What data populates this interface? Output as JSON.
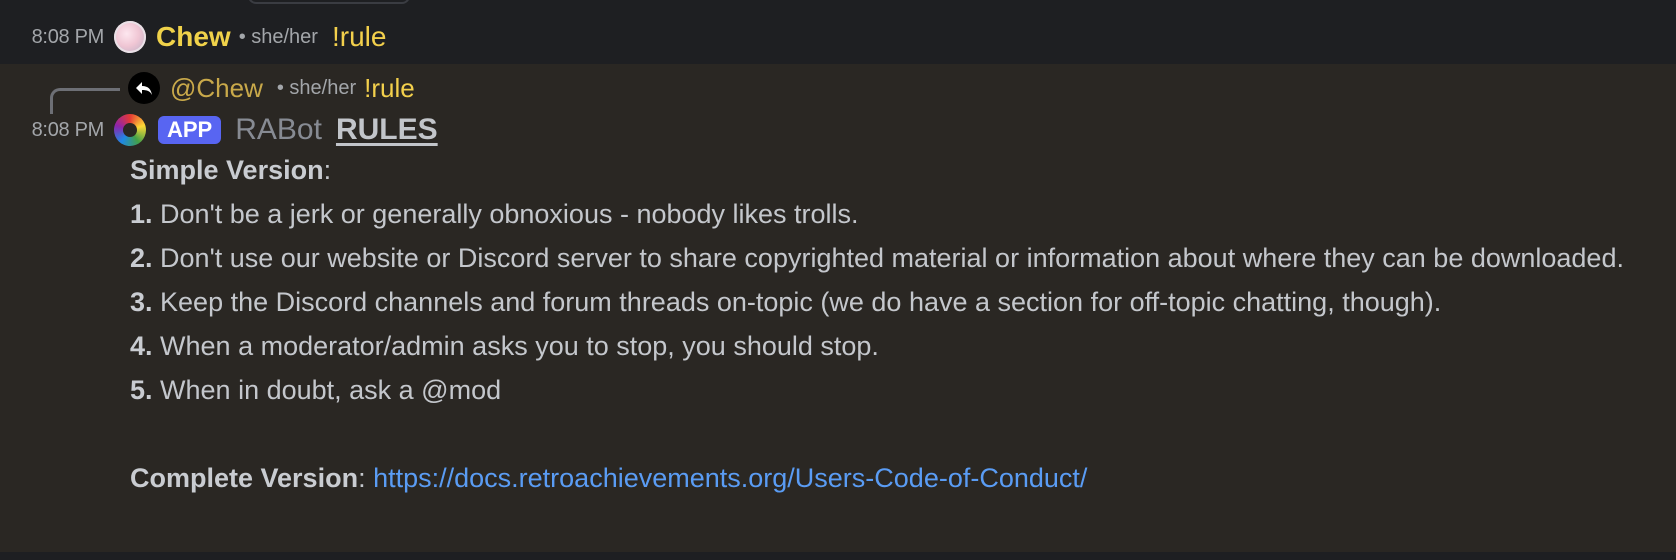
{
  "message1": {
    "timestamp": "8:08 PM",
    "author": "Chew",
    "pronouns": "• she/her",
    "text": "!rule"
  },
  "message2": {
    "reply": {
      "author": "@Chew",
      "pronouns": "• she/her",
      "text": "!rule"
    },
    "timestamp": "8:08 PM",
    "app_badge": "APP",
    "author": "RABot",
    "title": "RULES",
    "simple_label": "Simple Version",
    "colon": ":",
    "rules": [
      {
        "num": "1.",
        "text": " Don't be a jerk or generally obnoxious - nobody likes trolls."
      },
      {
        "num": "2.",
        "text": " Don't use our website or Discord server to share copyrighted material or information about where they can be downloaded."
      },
      {
        "num": "3.",
        "text": " Keep the Discord channels and forum threads on-topic (we do have a section for off-topic chatting, though)."
      },
      {
        "num": "4.",
        "text": " When a moderator/admin asks you to stop, you should stop."
      },
      {
        "num": "5.",
        "text": " When in doubt, ask a @mod"
      }
    ],
    "complete_label": "Complete Version",
    "complete_link": "https://docs.retroachievements.org/Users-Code-of-Conduct/"
  },
  "colors": {
    "chew_name": "#f0d24a",
    "app_badge": "#5865f2",
    "link": "#5a9cf4",
    "message_highlight": "#2a2723",
    "background": "#1e1f22"
  }
}
